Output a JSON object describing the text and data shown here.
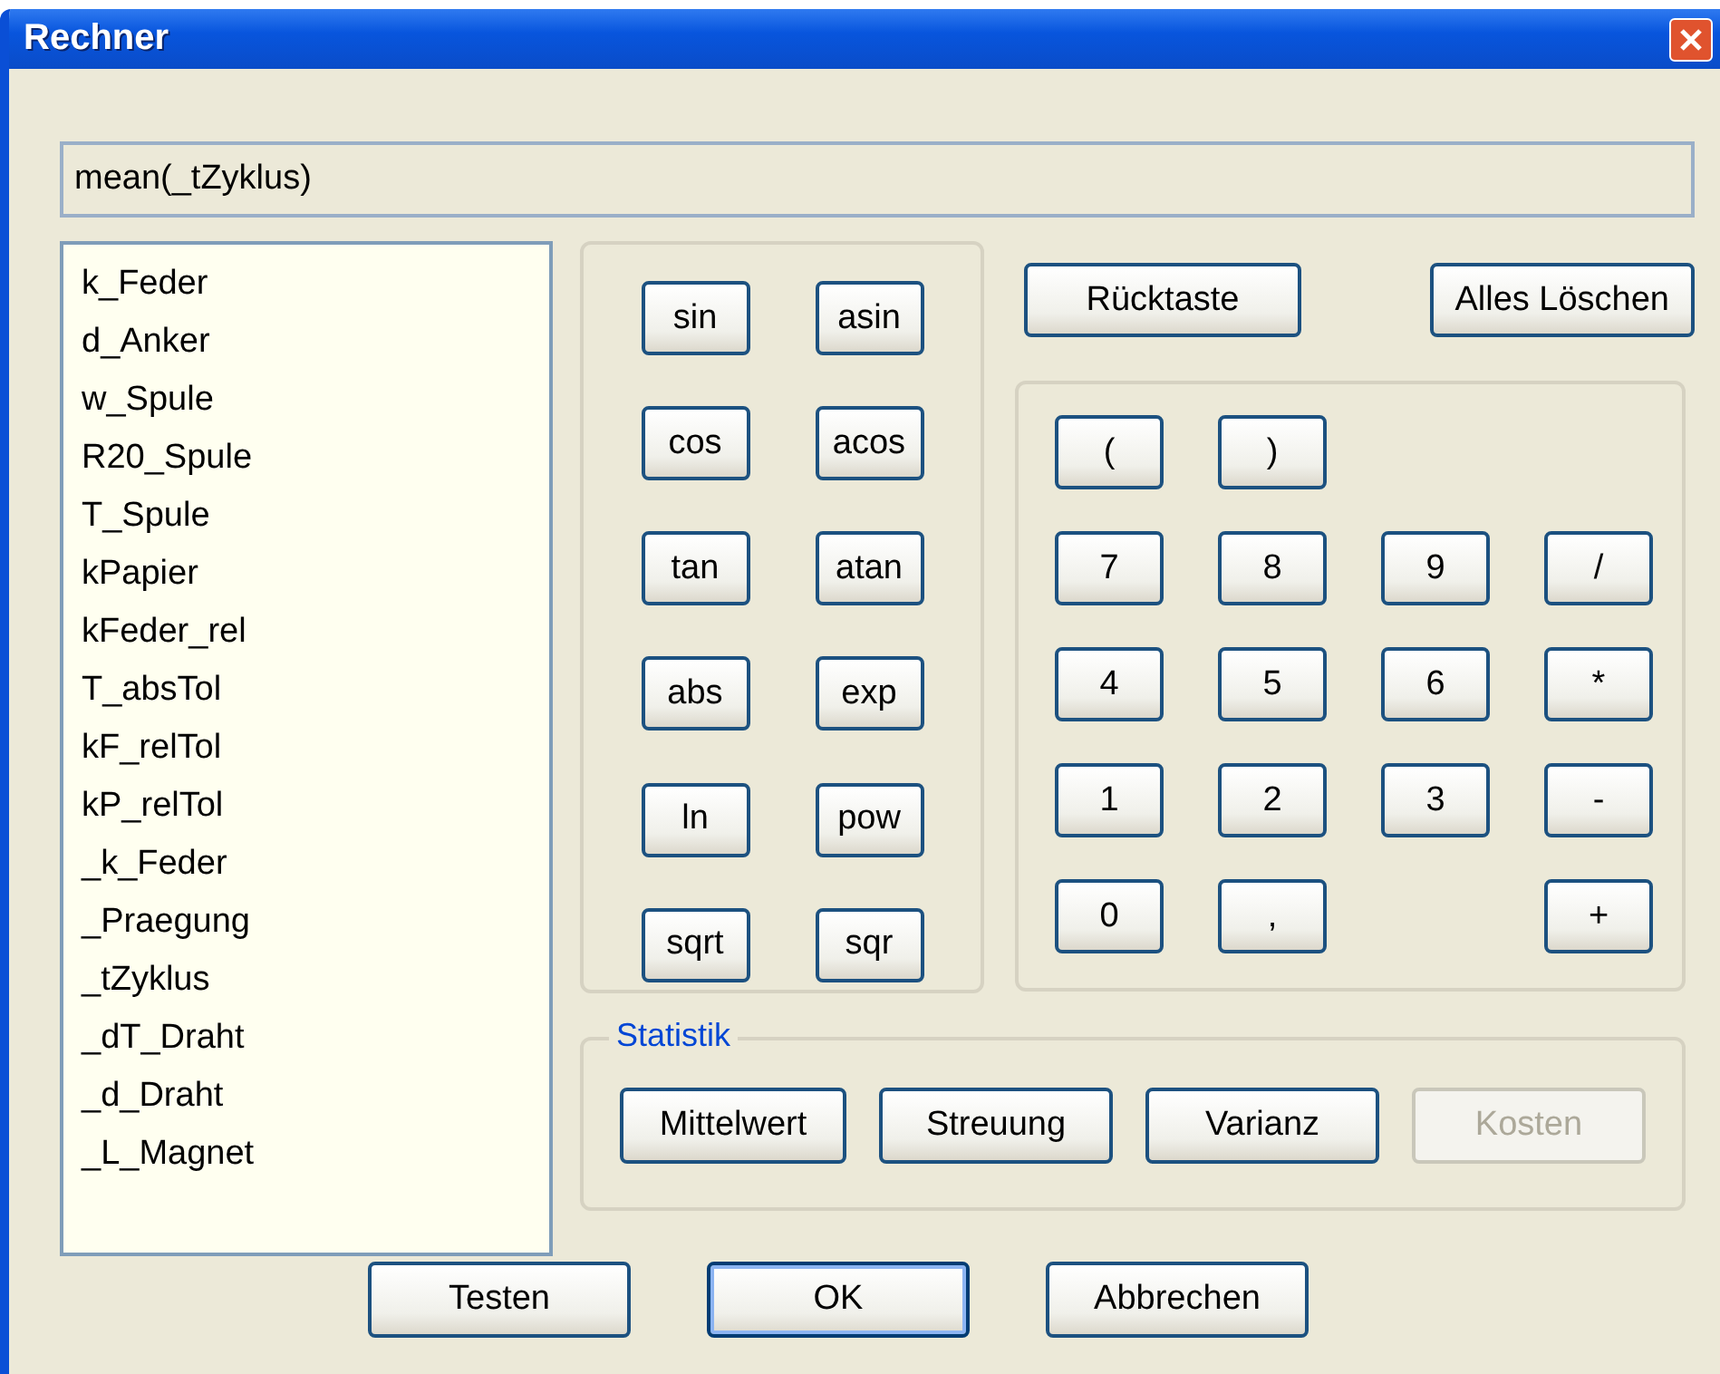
{
  "window": {
    "title": "Rechner"
  },
  "formula": {
    "value": "mean(_tZyklus)"
  },
  "variables": [
    {
      "label": "k_Feder"
    },
    {
      "label": "d_Anker"
    },
    {
      "label": "w_Spule"
    },
    {
      "label": "R20_Spule"
    },
    {
      "label": "T_Spule"
    },
    {
      "label": "kPapier"
    },
    {
      "label": "kFeder_rel"
    },
    {
      "label": "T_absTol"
    },
    {
      "label": "kF_relTol"
    },
    {
      "label": "kP_relTol"
    },
    {
      "label": "_k_Feder"
    },
    {
      "label": "_Praegung"
    },
    {
      "label": "_tZyklus"
    },
    {
      "label": "_dT_Draht"
    },
    {
      "label": "_d_Draht"
    },
    {
      "label": "_L_Magnet"
    }
  ],
  "function_keys": [
    "sin",
    "asin",
    "cos",
    "acos",
    "tan",
    "atan",
    "abs",
    "exp",
    "ln",
    "pow",
    "sqrt",
    "sqr"
  ],
  "edit_buttons": [
    "Rücktaste",
    "Alles Löschen"
  ],
  "number_keys": [
    [
      {
        "kind": "key",
        "label": "("
      },
      {
        "kind": "key",
        "label": ")"
      },
      {
        "kind": "gap"
      },
      {
        "kind": "gap"
      }
    ],
    [
      {
        "kind": "key",
        "label": "7"
      },
      {
        "kind": "key",
        "label": "8"
      },
      {
        "kind": "key",
        "label": "9"
      },
      {
        "kind": "key",
        "label": "/"
      }
    ],
    [
      {
        "kind": "key",
        "label": "4"
      },
      {
        "kind": "key",
        "label": "5"
      },
      {
        "kind": "key",
        "label": "6"
      },
      {
        "kind": "key",
        "label": "*"
      }
    ],
    [
      {
        "kind": "key",
        "label": "1"
      },
      {
        "kind": "key",
        "label": "2"
      },
      {
        "kind": "key",
        "label": "3"
      },
      {
        "kind": "key",
        "label": "-"
      }
    ],
    [
      {
        "kind": "key",
        "label": "0"
      },
      {
        "kind": "key",
        "label": ","
      },
      {
        "kind": "gap"
      },
      {
        "kind": "key",
        "label": "+"
      }
    ]
  ],
  "statistics": {
    "title": "Statistik",
    "buttons": [
      {
        "label": "Mittelwert",
        "disabled": false
      },
      {
        "label": "Streuung",
        "disabled": false
      },
      {
        "label": "Varianz",
        "disabled": false
      },
      {
        "label": "Kosten",
        "disabled": true
      }
    ]
  },
  "dialog_buttons": [
    {
      "label": "Testen",
      "default": false
    },
    {
      "label": "OK",
      "default": true
    },
    {
      "label": "Abbrechen",
      "default": false
    }
  ]
}
